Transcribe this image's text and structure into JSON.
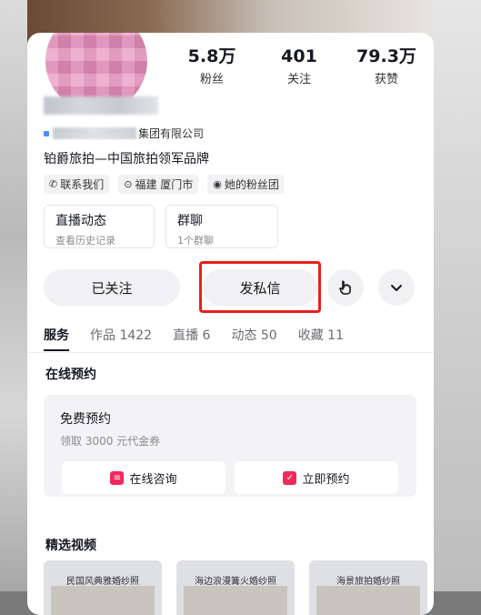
{
  "stats": [
    {
      "value": "5.8万",
      "label": "粉丝"
    },
    {
      "value": "401",
      "label": "关注"
    },
    {
      "value": "79.3万",
      "label": "获赞"
    }
  ],
  "profile": {
    "company_suffix": "集团有限公司",
    "bio": "铂爵旅拍—中国旅拍领军品牌"
  },
  "tags": [
    {
      "icon": "phone-icon",
      "label": "联系我们"
    },
    {
      "icon": "location-pin-icon",
      "label": "福建 厦门市"
    },
    {
      "icon": "eye-icon",
      "label": "她的粉丝团"
    }
  ],
  "features": [
    {
      "title": "直播动态",
      "subtitle": "查看历史记录"
    },
    {
      "title": "群聊",
      "subtitle": "1个群聊"
    }
  ],
  "actions": {
    "follow": "已关注",
    "message": "发私信"
  },
  "tabs": [
    {
      "label": "服务",
      "active": true
    },
    {
      "label": "作品 1422"
    },
    {
      "label": "直播 6"
    },
    {
      "label": "动态 50"
    },
    {
      "label": "收藏 11"
    }
  ],
  "booking_section": {
    "title": "在线预约",
    "card_title": "免费预约",
    "card_subtitle": "领取 3000 元代金券",
    "consult_label": "在线咨询",
    "book_label": "立即预约"
  },
  "videos_section": {
    "title": "精选视频",
    "items": [
      {
        "caption": "民国风典雅婚纱照"
      },
      {
        "caption": "海边浪漫篝火婚纱照"
      },
      {
        "caption": "海景旅拍婚纱照"
      }
    ]
  },
  "colors": {
    "highlight": "#e8201a",
    "accent": "#f0295d"
  }
}
